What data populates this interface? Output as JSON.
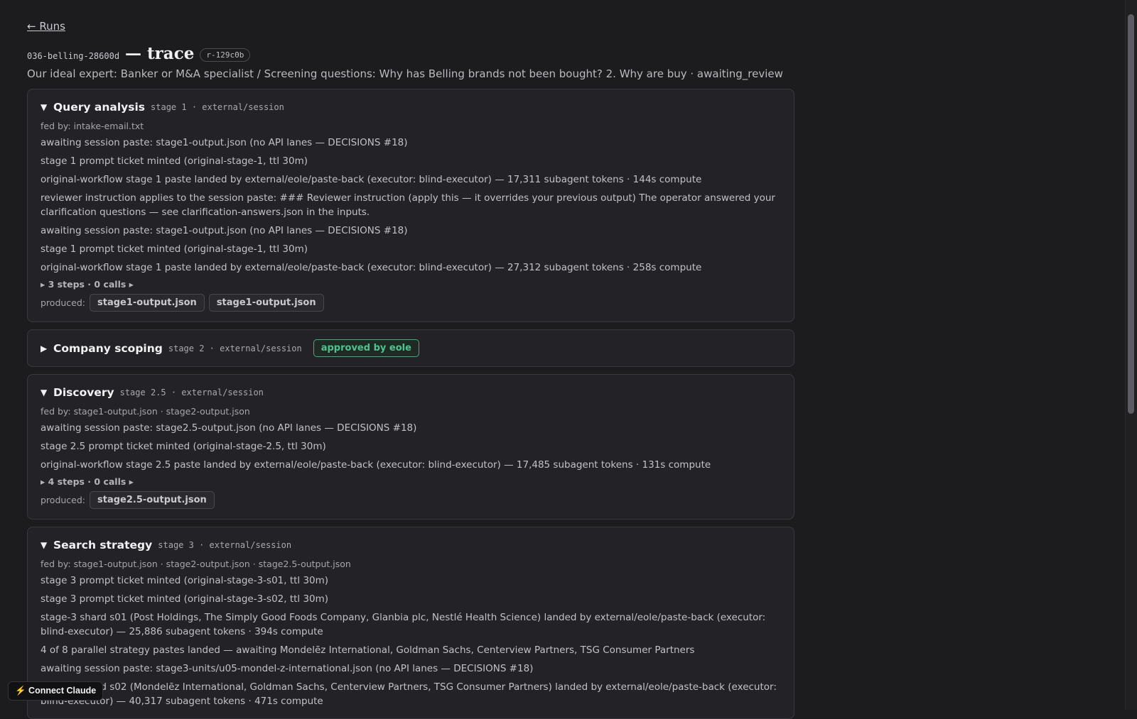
{
  "nav": {
    "back_label": "← Runs"
  },
  "header": {
    "run_slug": "036-belling-28600d",
    "title": "— trace",
    "run_id": "r-129c0b",
    "subtitle": "Our ideal expert: Banker or M&A specialist / Screening questions: Why has Belling brands not been bought? 2. Why are buy · awaiting_review"
  },
  "stages": [
    {
      "triangle": "▼",
      "name": "Query analysis",
      "meta": "stage 1 · external/session",
      "fed_by": "fed by: intake-email.txt",
      "lines": [
        "awaiting session paste: stage1-output.json (no API lanes — DECISIONS #18)",
        "stage 1 prompt ticket minted (original-stage-1, ttl 30m)",
        "original-workflow stage 1 paste landed by external/eole/paste-back (executor: blind-executor) — 17,311 subagent tokens · 144s compute",
        "reviewer instruction applies to the session paste: ### Reviewer instruction (apply this — it overrides your previous output) The operator answered your clarification questions — see clarification-answers.json in the inputs.",
        "awaiting session paste: stage1-output.json (no API lanes — DECISIONS #18)",
        "stage 1 prompt ticket minted (original-stage-1, ttl 30m)",
        "original-workflow stage 1 paste landed by external/eole/paste-back (executor: blind-executor) — 27,312 subagent tokens · 258s compute"
      ],
      "steps": "▸ 3 steps · 0 calls ▸",
      "produced_label": "produced:",
      "produced": [
        "stage1-output.json",
        "stage1-output.json"
      ]
    },
    {
      "triangle": "▶",
      "name": "Company scoping",
      "meta": "stage 2 · external/session",
      "badge": "approved by eole"
    },
    {
      "triangle": "▼",
      "name": "Discovery",
      "meta": "stage 2.5 · external/session",
      "fed_by": "fed by: stage1-output.json · stage2-output.json",
      "lines": [
        "awaiting session paste: stage2.5-output.json (no API lanes — DECISIONS #18)",
        "stage 2.5 prompt ticket minted (original-stage-2.5, ttl 30m)",
        "original-workflow stage 2.5 paste landed by external/eole/paste-back (executor: blind-executor) — 17,485 subagent tokens · 131s compute"
      ],
      "steps": "▸ 4 steps · 0 calls ▸",
      "produced_label": "produced:",
      "produced": [
        "stage2.5-output.json"
      ]
    },
    {
      "triangle": "▼",
      "name": "Search strategy",
      "meta": "stage 3 · external/session",
      "fed_by": "fed by: stage1-output.json · stage2-output.json · stage2.5-output.json",
      "lines": [
        "stage 3 prompt ticket minted (original-stage-3-s01, ttl 30m)",
        "stage 3 prompt ticket minted (original-stage-3-s02, ttl 30m)",
        "stage-3 shard s01 (Post Holdings, The Simply Good Foods Company, Glanbia plc, Nestlé Health Science) landed by external/eole/paste-back (executor: blind-executor) — 25,886 subagent tokens · 394s compute",
        "4 of 8 parallel strategy pastes landed — awaiting Mondelēz International, Goldman Sachs, Centerview Partners, TSG Consumer Partners",
        "awaiting session paste: stage3-units/u05-mondel-z-international.json (no API lanes — DECISIONS #18)",
        "stage-3 shard s02 (Mondelēz International, Goldman Sachs, Centerview Partners, TSG Consumer Partners) landed by external/eole/paste-back (executor: blind-executor) — 40,317 subagent tokens · 471s compute"
      ]
    }
  ],
  "footer": {
    "connect_label": "⚡ Connect Claude"
  }
}
